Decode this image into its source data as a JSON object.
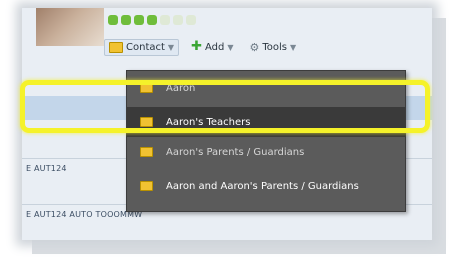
{
  "toolbar": {
    "contact_label": "Contact",
    "add_label": "Add",
    "tools_label": "Tools"
  },
  "background_rows": {
    "row1": "E AUT124",
    "row2": "E AUT124 AUTO TOOOMMW"
  },
  "dropdown": {
    "items": [
      {
        "label": "Aaron"
      },
      {
        "label": "Aaron's Teachers"
      },
      {
        "label": "Aaron's Parents / Guardians"
      },
      {
        "label": "Aaron and Aaron's Parents / Guardians"
      }
    ],
    "highlighted_index": 1
  },
  "colors": {
    "highlight_ring": "#f5f22a",
    "menu_bg": "#5b5b5b",
    "menu_hover": "#3a3a3a",
    "status_dot": "#6fbd3b"
  }
}
